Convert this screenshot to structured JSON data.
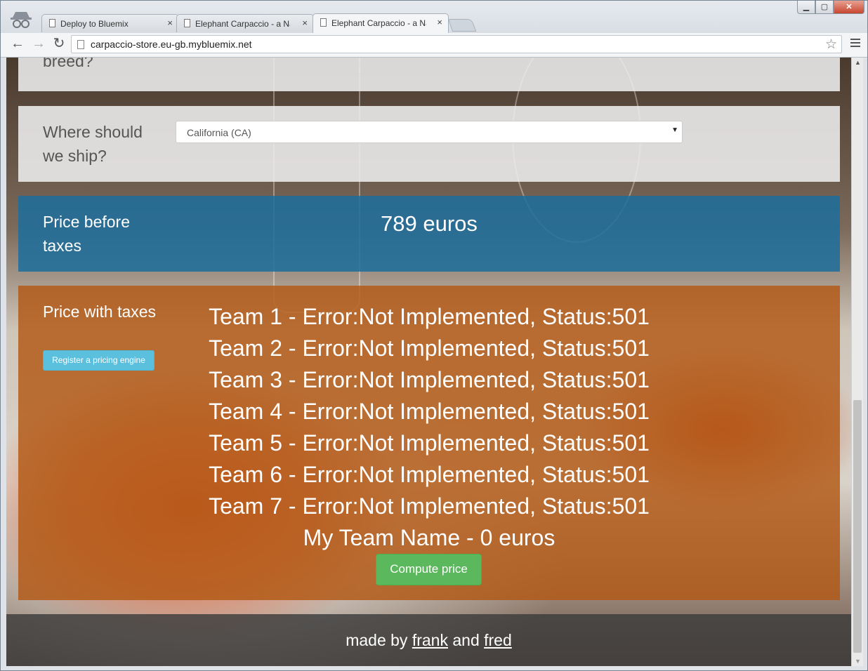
{
  "browser": {
    "tabs": [
      {
        "label": "Deploy to Bluemix",
        "active": false
      },
      {
        "label": "Elephant Carpaccio - a Na",
        "active": false
      },
      {
        "label": "Elephant Carpaccio - a Na",
        "active": true
      }
    ],
    "close_glyph": "×",
    "url": "carpaccio-store.eu-gb.mybluemix.net",
    "window_buttons": {
      "minimize": "▁",
      "maximize": "▢",
      "close": "✕"
    },
    "nav": {
      "back": "←",
      "forward": "→",
      "reload": "↻",
      "star": "☆"
    }
  },
  "form": {
    "breed_label": "breed?",
    "ship_label": "Where should we ship?",
    "ship_value": "California (CA)",
    "ship_arrow": "▼"
  },
  "price_before_taxes": {
    "label": "Price before taxes",
    "value": "789 euros"
  },
  "price_with_taxes": {
    "label": "Price with taxes",
    "register_button": "Register a pricing engine",
    "results": [
      "Team 1 - Error:Not Implemented, Status:501",
      "Team 2 - Error:Not Implemented, Status:501",
      "Team 3 - Error:Not Implemented, Status:501",
      "Team 4 - Error:Not Implemented, Status:501",
      "Team 5 - Error:Not Implemented, Status:501",
      "Team 6 - Error:Not Implemented, Status:501",
      "Team 7 - Error:Not Implemented, Status:501",
      "My Team Name - 0 euros"
    ],
    "compute_button": "Compute price"
  },
  "footer": {
    "prefix": "made by",
    "author1": "frank",
    "middle": "and",
    "author2": "fred"
  },
  "colors": {
    "price_panel": "#1c6d9c",
    "taxes_panel": "#b25814",
    "register_button": "#5bc0de",
    "compute_button": "#5cb85c"
  }
}
